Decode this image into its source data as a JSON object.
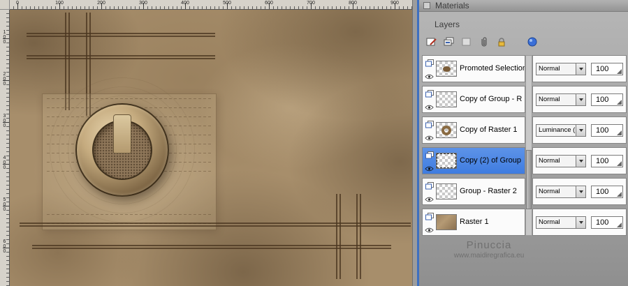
{
  "panels": {
    "materials": {
      "title": "Materials"
    },
    "layers": {
      "title": "Layers",
      "toolbar_icons": [
        "edit-layer-icon",
        "duplicate-layer-icon",
        "delete-layer-icon",
        "link-layers-icon",
        "lock-transparency-icon",
        "edit-selection-icon"
      ],
      "rows": [
        {
          "name": "Promoted Selection",
          "blend": "Normal",
          "opacity": "100",
          "selected": false,
          "thumb": "blob"
        },
        {
          "name": "Copy of Group - R",
          "blend": "Normal",
          "opacity": "100",
          "selected": false,
          "thumb": "empty"
        },
        {
          "name": "Copy of Raster 1",
          "blend": "Luminance (L)",
          "opacity": "100",
          "selected": false,
          "thumb": "ring"
        },
        {
          "name": "Copy (2) of Group",
          "blend": "Normal",
          "opacity": "100",
          "selected": true,
          "thumb": "empty"
        },
        {
          "name": "Group - Raster 2",
          "blend": "Normal",
          "opacity": "100",
          "selected": false,
          "thumb": "empty"
        },
        {
          "name": "Raster 1",
          "blend": "Normal",
          "opacity": "100",
          "selected": false,
          "thumb": "texture"
        }
      ],
      "watermark_line1": "Pinuccia",
      "watermark_line2": "www.maidiregrafica.eu"
    }
  },
  "rulers": {
    "h": [
      "0",
      "100",
      "200",
      "300",
      "400",
      "500",
      "600",
      "700",
      "800",
      "900"
    ],
    "v": [
      "100",
      "200",
      "300",
      "400",
      "500",
      "600"
    ]
  },
  "colors": {
    "selection_blue": "#3f7ce0",
    "sepia_base": "#a78e6b",
    "panel_gray": "#a3a3a3",
    "splitter_blue": "#3d6fc0"
  }
}
